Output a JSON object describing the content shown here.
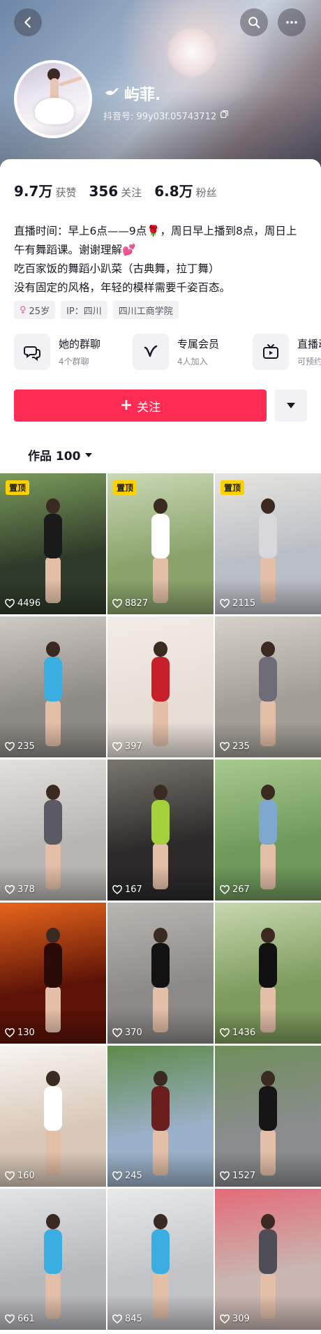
{
  "profile": {
    "nickname": "屿菲.",
    "douyin_id": "抖音号: 99y03f.05743712",
    "stats": [
      {
        "value": "9.7万",
        "label": "获赞"
      },
      {
        "value": "356",
        "label": "关注"
      },
      {
        "value": "6.8万",
        "label": "粉丝"
      }
    ],
    "bio": "直播时间：早上6点——9点🌹，周日早上播到8点，周日上午有舞蹈课。谢谢理解💕\n  吃百家饭的舞蹈小趴菜（古典舞，拉丁舞）\n没有固定的风格，年轻的模样需要千姿百态。",
    "tags": [
      "25岁",
      "IP：四川",
      "四川工商学院"
    ]
  },
  "features": [
    {
      "title": "她的群聊",
      "subtitle": "4个群聊",
      "icon": "chat-bubbles-icon"
    },
    {
      "title": "专属会员",
      "subtitle": "4人加入",
      "icon": "v-badge-icon"
    },
    {
      "title": "直播动态",
      "subtitle": "可预约",
      "icon": "tv-icon"
    }
  ],
  "actions": {
    "follow_label": "关注"
  },
  "works": {
    "header": "作品 100",
    "pin_label": "置顶",
    "items": [
      {
        "likes": "4496",
        "pinned": true,
        "bg": "#2f3b2a",
        "accent": "#7a9a5a",
        "outfit": "#1a1a1a"
      },
      {
        "likes": "8827",
        "pinned": true,
        "bg": "#8aa36a",
        "accent": "#c9d9b5",
        "outfit": "#ffffff"
      },
      {
        "likes": "2115",
        "pinned": true,
        "bg": "#b9bdc4",
        "accent": "#e6e4e0",
        "outfit": "#d8d8dc"
      },
      {
        "likes": "235",
        "pinned": false,
        "bg": "#8e8a86",
        "accent": "#cfcac4",
        "outfit": "#3aaee0"
      },
      {
        "likes": "397",
        "pinned": false,
        "bg": "#e7ded6",
        "accent": "#f2ece6",
        "outfit": "#c8202a"
      },
      {
        "likes": "235",
        "pinned": false,
        "bg": "#a29d96",
        "accent": "#d6d1c9",
        "outfit": "#6d6c78"
      },
      {
        "likes": "378",
        "pinned": false,
        "bg": "#b8b6b2",
        "accent": "#e2e0dc",
        "outfit": "#5b5a62"
      },
      {
        "likes": "167",
        "pinned": false,
        "bg": "#2c2a2a",
        "accent": "#7a766f",
        "outfit": "#a4d23a"
      },
      {
        "likes": "267",
        "pinned": false,
        "bg": "#6f9a5c",
        "accent": "#a9c98e",
        "outfit": "#7fa8cf"
      },
      {
        "likes": "130",
        "pinned": false,
        "bg": "#5c1207",
        "accent": "#e8651c",
        "outfit": "#2a0a05"
      },
      {
        "likes": "370",
        "pinned": false,
        "bg": "#8c8a88",
        "accent": "#b9b6b2",
        "outfit": "#121212"
      },
      {
        "likes": "1436",
        "pinned": false,
        "bg": "#7e9b5d",
        "accent": "#c6d8ae",
        "outfit": "#111111"
      },
      {
        "likes": "160",
        "pinned": false,
        "bg": "#d9c8b8",
        "accent": "#f7f4f1",
        "outfit": "#ffffff"
      },
      {
        "likes": "245",
        "pinned": false,
        "bg": "#9ab0c8",
        "accent": "#5e8a4a",
        "outfit": "#6a1e1e"
      },
      {
        "likes": "1527",
        "pinned": false,
        "bg": "#8a8c8e",
        "accent": "#6f8f5a",
        "outfit": "#161616"
      },
      {
        "likes": "661",
        "pinned": false,
        "bg": "#b7b8bc",
        "accent": "#e3e4e6",
        "outfit": "#3aaee0"
      },
      {
        "likes": "845",
        "pinned": false,
        "bg": "#c2c3c6",
        "accent": "#e8e9eb",
        "outfit": "#3aaee0"
      },
      {
        "likes": "309",
        "pinned": false,
        "bg": "#c9b6b0",
        "accent": "#e46b7a",
        "outfit": "#4f4e58"
      }
    ]
  },
  "colors": {
    "accent": "#fe2c55",
    "pin_badge": "#fcd100"
  }
}
